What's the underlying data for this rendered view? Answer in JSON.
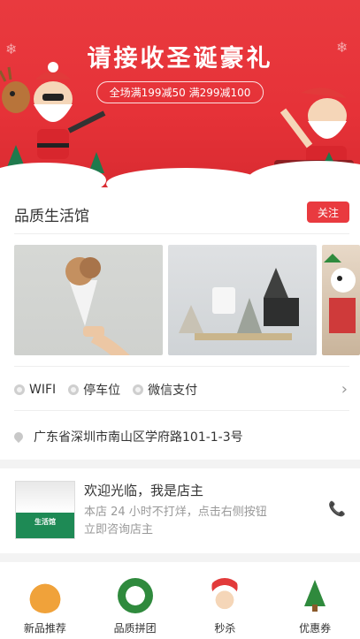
{
  "banner": {
    "title": "请接收圣诞豪礼",
    "promo": "全场满199减50 满299减100"
  },
  "store": {
    "title": "品质生活馆",
    "follow_label": "关注",
    "amenities": [
      "WIFI",
      "停车位",
      "微信支付"
    ],
    "address": "广东省深圳市南山区学府路101-1-3号"
  },
  "owner": {
    "image_tag": "生活馆",
    "title": "欢迎光临，我是店主",
    "description": "本店 24 小时不打烊，点击右侧按钮立即咨询店主"
  },
  "nav": {
    "items": [
      {
        "label": "新品推荐",
        "icon": "reindeer-icon"
      },
      {
        "label": "品质拼团",
        "icon": "wreath-icon"
      },
      {
        "label": "秒杀",
        "icon": "santa-icon"
      },
      {
        "label": "优惠券",
        "icon": "tree-icon"
      }
    ]
  },
  "colors": {
    "brand_red": "#e93a3f",
    "green": "#1e8a55"
  }
}
